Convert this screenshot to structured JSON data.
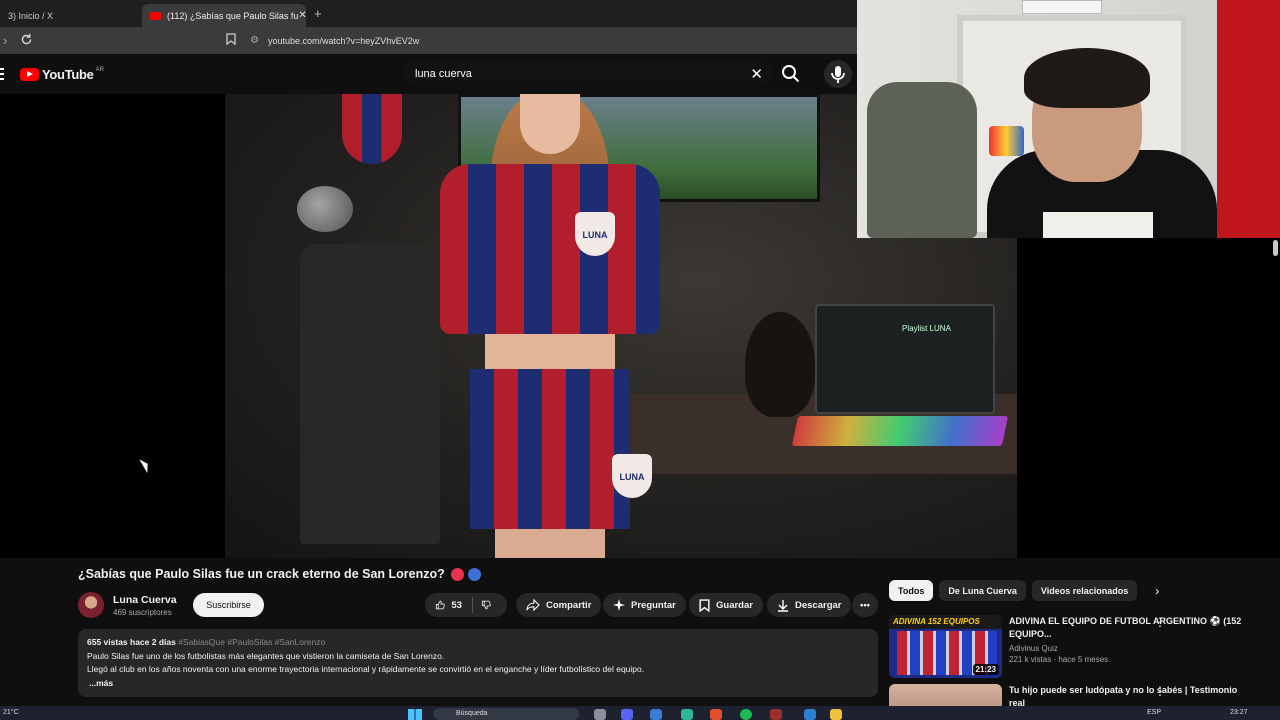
{
  "browser": {
    "tabs": [
      {
        "label": "3) Inicio / X",
        "active": false
      },
      {
        "label": "(112) ¿Sabías que Paulo Silas fu",
        "active": true
      }
    ],
    "url": "youtube.com/watch?v=heyZVhvEV2w"
  },
  "youtube": {
    "logo_text": "YouTube",
    "country_code": "AR",
    "search_value": "luna cuerva"
  },
  "video": {
    "overlay": {
      "jersey_badge": "LUNA",
      "laptop_title": "Playlist LUNA"
    },
    "title": "¿Sabías que Paulo Silas fue un crack eterno de San Lorenzo?",
    "title_dots": [
      "#e8334f",
      "#3e6fd6"
    ],
    "channel_name": "Luna Cuerva",
    "subscribers": "469 suscriptores",
    "subscribe_label": "Suscribirse",
    "likes": "53",
    "actions": {
      "share": "Compartir",
      "ask": "Preguntar",
      "save": "Guardar",
      "download": "Descargar"
    },
    "description": {
      "views_date": "655 vistas  hace 2 días",
      "hashtags": "#SabiasQue #PauloSilas #SanLorenzo",
      "line1": "Paulo Silas fue uno de los futbolistas más elegantes que vistieron la camiseta de San Lorenzo.",
      "line2": "Llegó al club en los años noventa con una enorme trayectoria internacional y rápidamente se convirtió en el enganche y líder futbolístico del equipo.",
      "more": "...más"
    }
  },
  "sidebar": {
    "chips": [
      "Todos",
      "De Luna Cuerva",
      "Videos relacionados"
    ],
    "recommendations": [
      {
        "title": "ADIVINA EL EQUIPO DE FUTBOL ARGENTINO ⚽ (152 EQUIPO...",
        "channel": "Adivinus Quiz",
        "meta": "221 k vistas · hace 5 meses",
        "duration": "21:23",
        "thumb_banner": "ADIVINA 152 EQUIPOS"
      },
      {
        "title": "Tu hijo puede ser ludópata y no lo sabés | Testimonio real",
        "channel": "",
        "meta": "",
        "duration": "",
        "thumb_banner": ""
      }
    ]
  },
  "taskbar": {
    "temperature": "21°C",
    "search_placeholder": "Búsqueda",
    "language": "ESP",
    "time": "23:27"
  },
  "colors": {
    "youtube_red": "#ff0000",
    "background": "#0f0f0f",
    "pill": "#272727",
    "jersey_red": "#b31e2c",
    "jersey_blue": "#1e2d72"
  }
}
